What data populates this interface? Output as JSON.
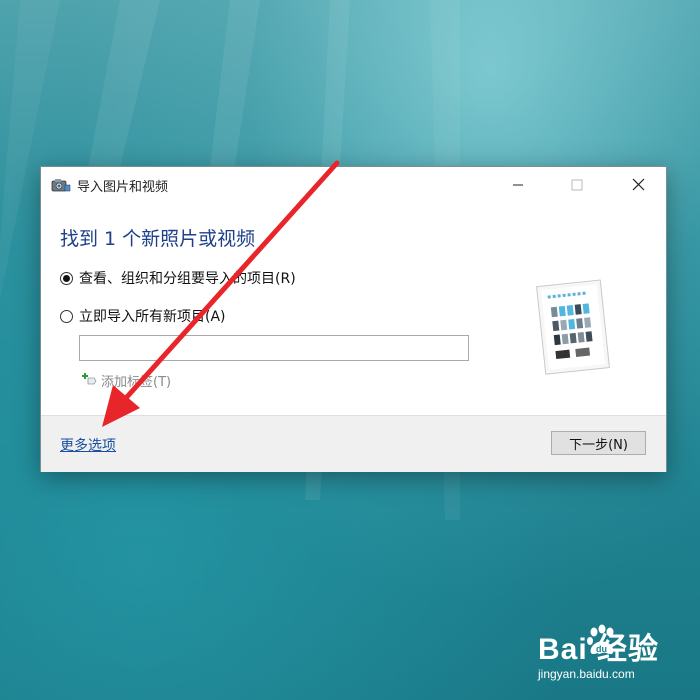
{
  "dialog": {
    "title": "导入图片和视频",
    "heading": "找到 1 个新照片或视频",
    "option_review": "查看、组织和分组要导入的项目(R)",
    "option_import_all": "立即导入所有新项目(A)",
    "tag_input_value": "",
    "add_tag_label": "添加标签(T)",
    "more_options": "更多选项",
    "next_button": "下一步(N)",
    "selected_option": "review"
  },
  "window_controls": {
    "minimize": "minimize-icon",
    "maximize": "maximize-icon",
    "close": "close-icon"
  },
  "annotation": {
    "color": "#e8252a"
  },
  "watermark": {
    "text_main": "Bai  经验",
    "text_sub": "jingyan.baidu.com"
  }
}
